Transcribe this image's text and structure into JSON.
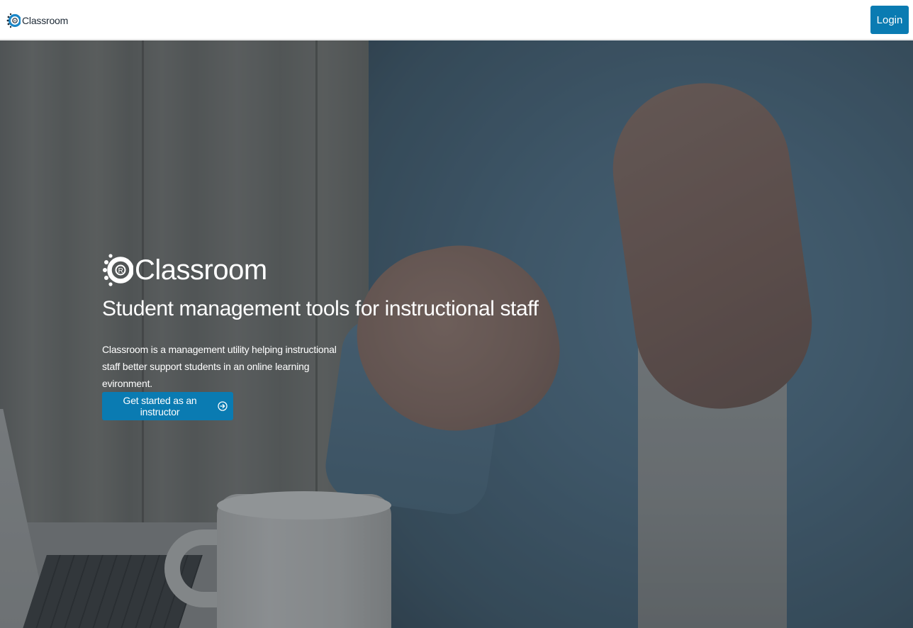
{
  "header": {
    "brand_name": "Classroom",
    "login_label": "Login"
  },
  "hero": {
    "brand_name": "Classroom",
    "title": "Student management tools for instructional staff",
    "description": "Classroom is a management utility helping instructional staff better support students in an online learning evironment.",
    "cta_label": "Get started as an instructor",
    "cta_icon": "arrow-circle-right-icon"
  },
  "colors": {
    "primary": "#0a7bb2",
    "logo_blue": "#1a86c7",
    "text_dark": "#1e2a36"
  }
}
